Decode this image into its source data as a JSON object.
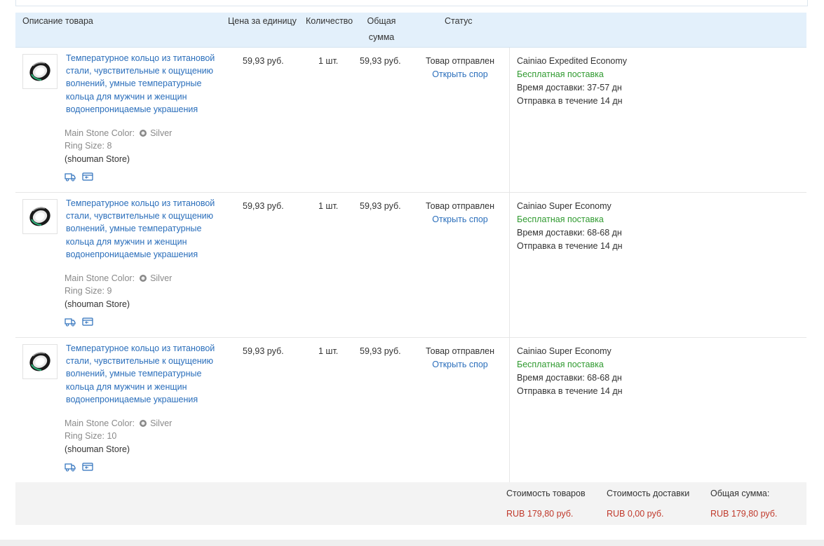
{
  "table_header": {
    "description": "Описание товара",
    "unit_price": "Цена за единицу",
    "quantity": "Количество",
    "total_line1": "Общая",
    "total_line2": "сумма",
    "status": "Статус"
  },
  "items": [
    {
      "title": "Температурное кольцо из титановой стали, чувствительные к ощущению волнений, умные температурные кольца для мужчин и женщин водонепроницаемые украшения",
      "color_label": "Main Stone Color:",
      "color_value": "Silver",
      "size_label": "Ring Size:",
      "size_value": "8",
      "store": "(shouman Store)",
      "price": "59,93 руб.",
      "qty": "1 шт.",
      "total": "59,93 руб.",
      "status": "Товар отправлен",
      "dispute": "Открыть спор",
      "carrier": "Cainiao Expedited Economy",
      "free_shipping": "Бесплатная поставка",
      "delivery_label": "Время доставки:",
      "delivery_value": "37-57 дн",
      "dispatch_label": "Отправка в течение",
      "dispatch_value": "14 дн"
    },
    {
      "title": "Температурное кольцо из титановой стали, чувствительные к ощущению волнений, умные температурные кольца для мужчин и женщин водонепроницаемые украшения",
      "color_label": "Main Stone Color:",
      "color_value": "Silver",
      "size_label": "Ring Size:",
      "size_value": "9",
      "store": "(shouman Store)",
      "price": "59,93 руб.",
      "qty": "1 шт.",
      "total": "59,93 руб.",
      "status": "Товар отправлен",
      "dispute": "Открыть спор",
      "carrier": "Cainiao Super Economy",
      "free_shipping": "Бесплатная поставка",
      "delivery_label": "Время доставки:",
      "delivery_value": "68-68 дн",
      "dispatch_label": "Отправка в течение",
      "dispatch_value": "14 дн"
    },
    {
      "title": "Температурное кольцо из титановой стали, чувствительные к ощущению волнений, умные температурные кольца для мужчин и женщин водонепроницаемые украшения",
      "color_label": "Main Stone Color:",
      "color_value": "Silver",
      "size_label": "Ring Size:",
      "size_value": "10",
      "store": "(shouman Store)",
      "price": "59,93 руб.",
      "qty": "1 шт.",
      "total": "59,93 руб.",
      "status": "Товар отправлен",
      "dispute": "Открыть спор",
      "carrier": "Cainiao Super Economy",
      "free_shipping": "Бесплатная поставка",
      "delivery_label": "Время доставки:",
      "delivery_value": "68-68 дн",
      "dispatch_label": "Отправка в течение",
      "dispatch_value": "14 дн"
    }
  ],
  "summary": {
    "goods_label": "Стоимость товаров",
    "goods_value": "RUB 179,80 руб.",
    "shipping_label": "Стоимость доставки",
    "shipping_value": "RUB 0,00 руб.",
    "total_label": "Общая сумма:",
    "total_value": "RUB 179,80 руб."
  },
  "colors": {
    "link": "#2a6ebb",
    "free_shipping": "#2f9a2f",
    "price_red": "#c0392b",
    "header_bg": "#e3f0fb"
  },
  "icons": [
    "ring-product-icon",
    "gem-icon",
    "shipping-truck-icon",
    "order-card-icon"
  ]
}
